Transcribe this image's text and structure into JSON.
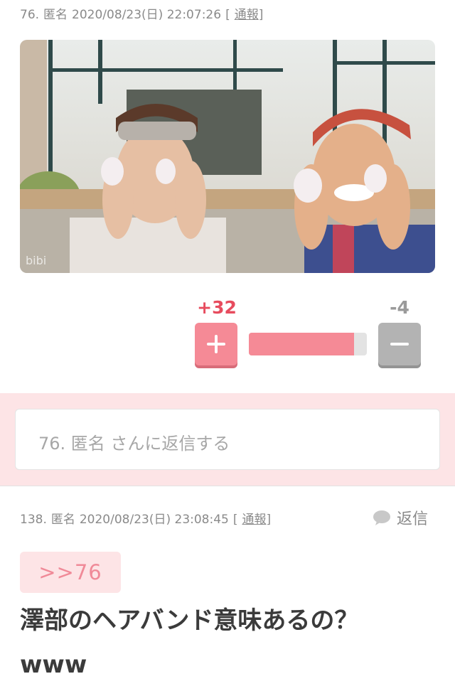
{
  "comment76": {
    "number": "76.",
    "author": "匿名",
    "datetime": "2020/08/23(日) 22:07:26",
    "report_open": "[",
    "report_label": "通報",
    "report_close": "]",
    "image_watermark": "bibi"
  },
  "vote": {
    "plus_count": "+32",
    "minus_count": "-4",
    "plus_share": 0.89,
    "colors": {
      "plus": "#f58a96",
      "minus": "#b3b3b3",
      "plus_text": "#e74c5e"
    }
  },
  "reply_box": {
    "placeholder": "76. 匿名 さんに返信する"
  },
  "comment138": {
    "number": "138.",
    "author": "匿名",
    "datetime": "2020/08/23(日) 23:08:45",
    "report_open": "[",
    "report_label": "通報",
    "report_close": "]",
    "reply_label": "返信",
    "anchor": ">>76",
    "body_line1": "澤部のヘアバンド意味あるの？",
    "body_line2": "www"
  },
  "icons": [
    "plus-icon",
    "minus-icon",
    "speech-bubble-icon"
  ]
}
